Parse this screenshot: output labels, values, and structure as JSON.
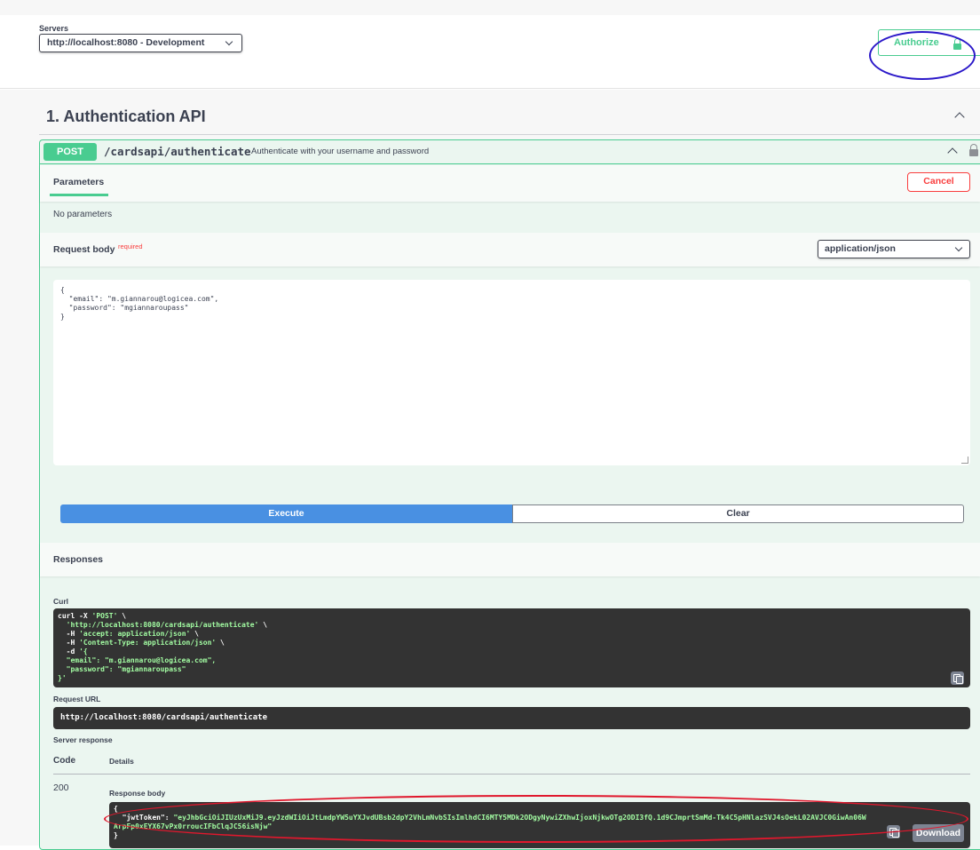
{
  "servers": {
    "label": "Servers",
    "selected": "http://localhost:8080 - Development"
  },
  "authorize": {
    "label": "Authorize"
  },
  "tag": {
    "title": "1. Authentication API"
  },
  "operation": {
    "method": "POST",
    "path": "/cardsapi/authenticate",
    "summary": "Authenticate with your username and password"
  },
  "parameters": {
    "tab_label": "Parameters",
    "cancel_label": "Cancel",
    "empty_text": "No parameters"
  },
  "request_body": {
    "label": "Request body",
    "required_label": "required",
    "content_type": "application/json",
    "value": "{\n  \"email\": \"m.giannarou@logicea.com\",\n  \"password\": \"mgiannaroupass\"\n}"
  },
  "actions": {
    "execute_label": "Execute",
    "clear_label": "Clear"
  },
  "responses": {
    "heading": "Responses",
    "curl_label": "Curl",
    "curl_line1": "curl -X ",
    "curl_method": "'POST'",
    "curl_line1_end": " \\",
    "curl_url": "  'http://localhost:8080/cardsapi/authenticate'",
    "curl_line2_end": " \\",
    "curl_h1_flag": "  -H ",
    "curl_h1": "'accept: application/json'",
    "curl_h1_end": " \\",
    "curl_h2_flag": "  -H ",
    "curl_h2": "'Content-Type: application/json'",
    "curl_h2_end": " \\",
    "curl_d_flag": "  -d ",
    "curl_d_body": "'{\n  \"email\": \"m.giannarou@logicea.com\",\n  \"password\": \"mgiannaroupass\"\n}'",
    "request_url_label": "Request URL",
    "request_url": "http://localhost:8080/cardsapi/authenticate",
    "server_response_label": "Server response",
    "code_header": "Code",
    "details_header": "Details",
    "code": "200",
    "response_body_label": "Response body",
    "body_open": "{",
    "body_key": "  \"jwtToken\": ",
    "body_token": "\"eyJhbGciOiJIUzUxMiJ9.eyJzdWIiOiJtLmdpYW5uYXJvdUBsb2dpY2VhLmNvbSIsImlhdCI6MTY5MDk2ODgyNywiZXhwIjoxNjkwOTg2ODI3fQ.1d9CJmprtSmMd-Tk4C5pHNlazSVJ4sOekL02AVJC0GiwAn06W\nArpFp0xEYX67vPx0rroucIFbClqJC56isNjw\"",
    "body_close": "}",
    "download_label": "Download"
  },
  "icons": {
    "servers_dropdown": "chevron-down-icon",
    "authorize_lock": "lock-icon",
    "collapse": "chevron-up-icon",
    "copy": "copy-icon"
  },
  "colors": {
    "post": "#49cc90",
    "execute": "#4990e2",
    "cancel": "#f93e3e",
    "code_bg": "#333333",
    "annotation_blue": "#2b18c9",
    "annotation_red": "#e0182d"
  }
}
